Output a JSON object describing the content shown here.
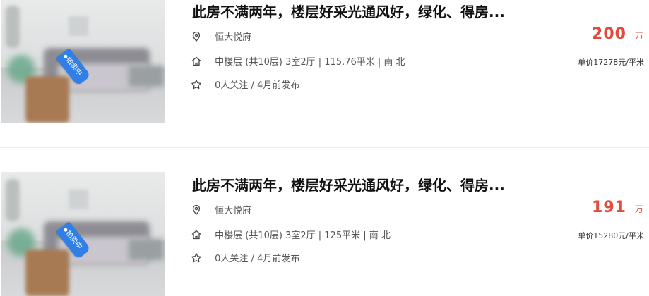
{
  "listings": [
    {
      "title": "此房不满两年，楼层好采光通风好，绿化、得房...",
      "tag": "拍卖中",
      "community": "恒大悦府",
      "details": "中楼层 (共10层) 3室2厅 | 115.76平米 | 南 北",
      "meta": "0人关注 / 4月前发布",
      "price": "200",
      "price_unit": "万",
      "unit_price": "单价17278元/平米"
    },
    {
      "title": "此房不满两年，楼层好采光通风好，绿化、得房...",
      "tag": "拍卖中",
      "community": "恒大悦府",
      "details": "中楼层 (共10层) 3室2厅 | 125平米 | 南 北",
      "meta": "0人关注 / 4月前发布",
      "price": "191",
      "price_unit": "万",
      "unit_price": "单价15280元/平米"
    }
  ],
  "colors": {
    "price": "#e24b3b",
    "tag": "#2f7fe6",
    "title": "#121212"
  },
  "icons": {
    "community": "location-pin-icon",
    "details": "home-icon",
    "meta": "star-icon"
  }
}
